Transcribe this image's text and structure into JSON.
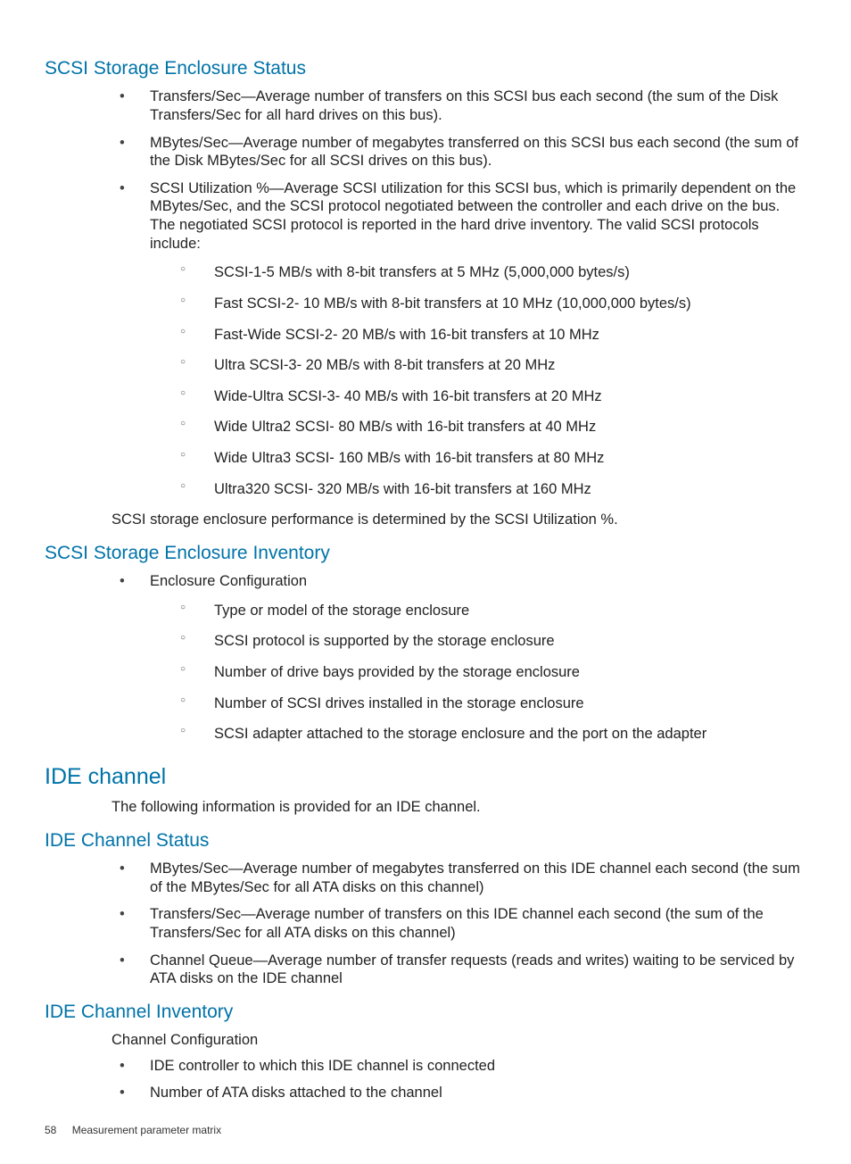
{
  "sections": {
    "scsi_status": {
      "heading": "SCSI Storage Enclosure Status",
      "bullets": [
        "Transfers/Sec—Average number of transfers on this SCSI bus each second (the sum of the Disk Transfers/Sec for all hard drives on this bus).",
        "MBytes/Sec—Average number of megabytes transferred on this SCSI bus each second (the sum of the Disk MBytes/Sec for all SCSI drives on this bus).",
        "SCSI Utilization %—Average SCSI utilization for this SCSI bus, which is primarily dependent on the MBytes/Sec, and the SCSI protocol negotiated between the controller and each drive on the bus. The negotiated SCSI protocol is reported in the hard drive inventory. The valid SCSI protocols include:"
      ],
      "sub_under_bullet3": [
        "SCSI-1-5 MB/s with 8-bit transfers at 5 MHz (5,000,000 bytes/s)",
        "Fast SCSI-2- 10 MB/s with 8-bit transfers at 10 MHz (10,000,000 bytes/s)",
        "Fast-Wide SCSI-2- 20 MB/s with 16-bit transfers at 10 MHz",
        "Ultra SCSI-3- 20 MB/s with 8-bit transfers at 20 MHz",
        "Wide-Ultra SCSI-3- 40 MB/s with 16-bit transfers at 20 MHz",
        "Wide Ultra2 SCSI- 80 MB/s with 16-bit transfers at 40 MHz",
        "Wide Ultra3 SCSI- 160 MB/s with 16-bit transfers at 80 MHz",
        "Ultra320 SCSI- 320 MB/s with 16-bit transfers at 160 MHz"
      ],
      "closing": "SCSI storage enclosure performance is determined by the SCSI Utilization %."
    },
    "scsi_inventory": {
      "heading": "SCSI Storage Enclosure Inventory",
      "bullets": [
        "Enclosure Configuration"
      ],
      "sub_under_bullet1": [
        "Type or model of the storage enclosure",
        "SCSI protocol is supported by the storage enclosure",
        "Number of drive bays provided by the storage enclosure",
        "Number of SCSI drives installed in the storage enclosure",
        "SCSI adapter attached to the storage enclosure and the port on the adapter"
      ]
    },
    "ide_channel": {
      "heading": "IDE channel",
      "intro": "The following information is provided for an IDE channel."
    },
    "ide_status": {
      "heading": "IDE Channel Status",
      "bullets": [
        "MBytes/Sec—Average number of megabytes transferred on this IDE channel each second (the sum of the MBytes/Sec for all ATA disks on this channel)",
        "Transfers/Sec—Average number of transfers on this IDE channel each second (the sum of the Transfers/Sec for all ATA disks on this channel)",
        "Channel Queue—Average number of transfer requests (reads and writes) waiting to be serviced by ATA disks on the IDE channel"
      ]
    },
    "ide_inventory": {
      "heading": "IDE Channel Inventory",
      "intro": "Channel Configuration",
      "bullets": [
        "IDE controller to which this IDE channel is connected",
        "Number of ATA disks attached to the channel"
      ]
    }
  },
  "footer": {
    "page_number": "58",
    "title": "Measurement parameter matrix"
  }
}
